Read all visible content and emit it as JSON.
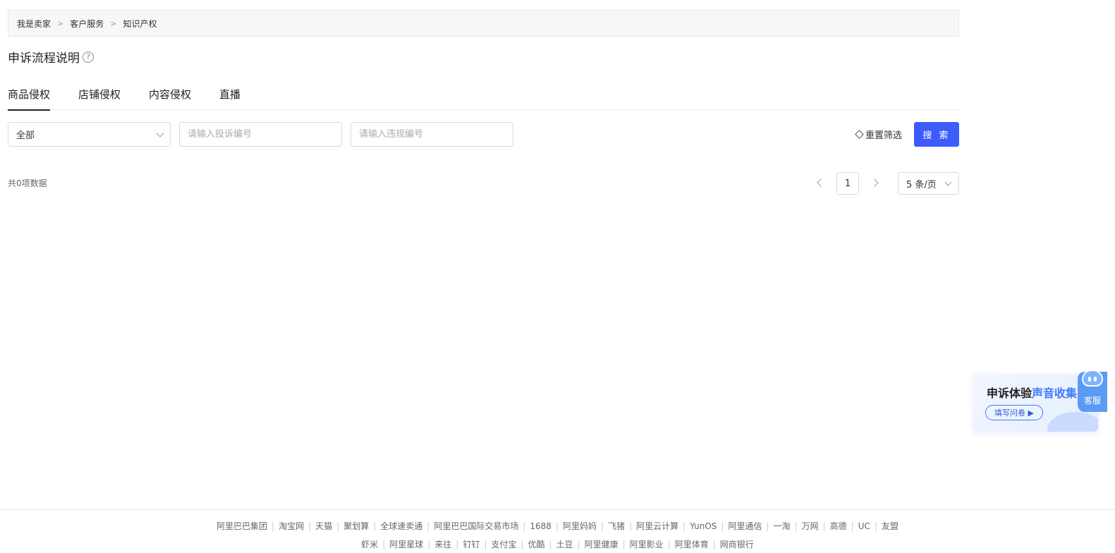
{
  "breadcrumb": {
    "items": [
      "我是卖家",
      "客户服务",
      "知识产权"
    ],
    "separator": ">"
  },
  "page": {
    "title": "申诉流程说明",
    "help_icon": "?"
  },
  "tabs": [
    "商品侵权",
    "店铺侵权",
    "内容侵权",
    "直播"
  ],
  "active_tab": 0,
  "filters": {
    "type_select": "全部",
    "complaint_placeholder": "请输入投诉编号",
    "violation_placeholder": "请输入违规编号",
    "reset_label": "重置筛选",
    "search_label": "搜 索"
  },
  "result": {
    "total_text": "共0项数据"
  },
  "pagination": {
    "current_page": "1",
    "page_size": "5 条/页"
  },
  "feedback": {
    "title_a": "申诉体验",
    "title_b": "声音收集",
    "button": "填写问卷 ▶"
  },
  "service": {
    "label": "客服"
  },
  "footer": {
    "row1": [
      "阿里巴巴集团",
      "淘宝网",
      "天猫",
      "聚划算",
      "全球速卖通",
      "阿里巴巴国际交易市场",
      "1688",
      "阿里妈妈",
      "飞猪",
      "阿里云计算",
      "YunOS",
      "阿里通信",
      "一淘",
      "万网",
      "高德",
      "UC",
      "友盟"
    ],
    "row2": [
      "虾米",
      "阿里星球",
      "来往",
      "钉钉",
      "支付宝",
      "优酷",
      "土豆",
      "阿里健康",
      "阿里影业",
      "阿里体育",
      "网商银行"
    ]
  },
  "colors": {
    "primary": "#3d5cfc",
    "accent_blue": "#3d7bfc",
    "service_blue": "#5b9af5"
  }
}
